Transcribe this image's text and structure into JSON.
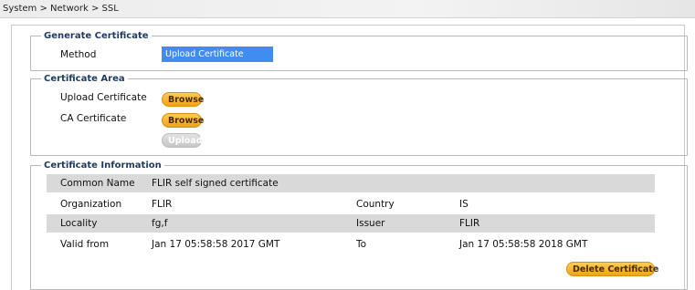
{
  "breadcrumb": "System > Network > SSL",
  "generate": {
    "legend": "Generate Certificate",
    "method_label": "Method",
    "method_value": "Upload Certificate"
  },
  "area": {
    "legend": "Certificate Area",
    "upload_label": "Upload Certificate",
    "ca_label": "CA Certificate",
    "browse_label": "Browse",
    "upload_button": "Upload"
  },
  "info": {
    "legend": "Certificate Information",
    "rows": [
      {
        "label": "Common Name",
        "value": "FLIR self signed certificate"
      },
      {
        "label": "Organization",
        "value": "FLIR",
        "label2": "Country",
        "value2": "IS"
      },
      {
        "label": "Locality",
        "value": "fg,f",
        "label2": "Issuer",
        "value2": "FLIR"
      },
      {
        "label": "Valid from",
        "value": "Jan 17 05:58:58 2017 GMT",
        "label2": "To",
        "value2": "Jan 17 05:58:58 2018 GMT"
      }
    ],
    "delete_button": "Delete Certificate"
  },
  "colors": {
    "accent_blue": "#3f8df0",
    "button_orange": "#f0a21a",
    "row_shade": "#d9d9d9",
    "legend_text": "#1f3a5f"
  }
}
